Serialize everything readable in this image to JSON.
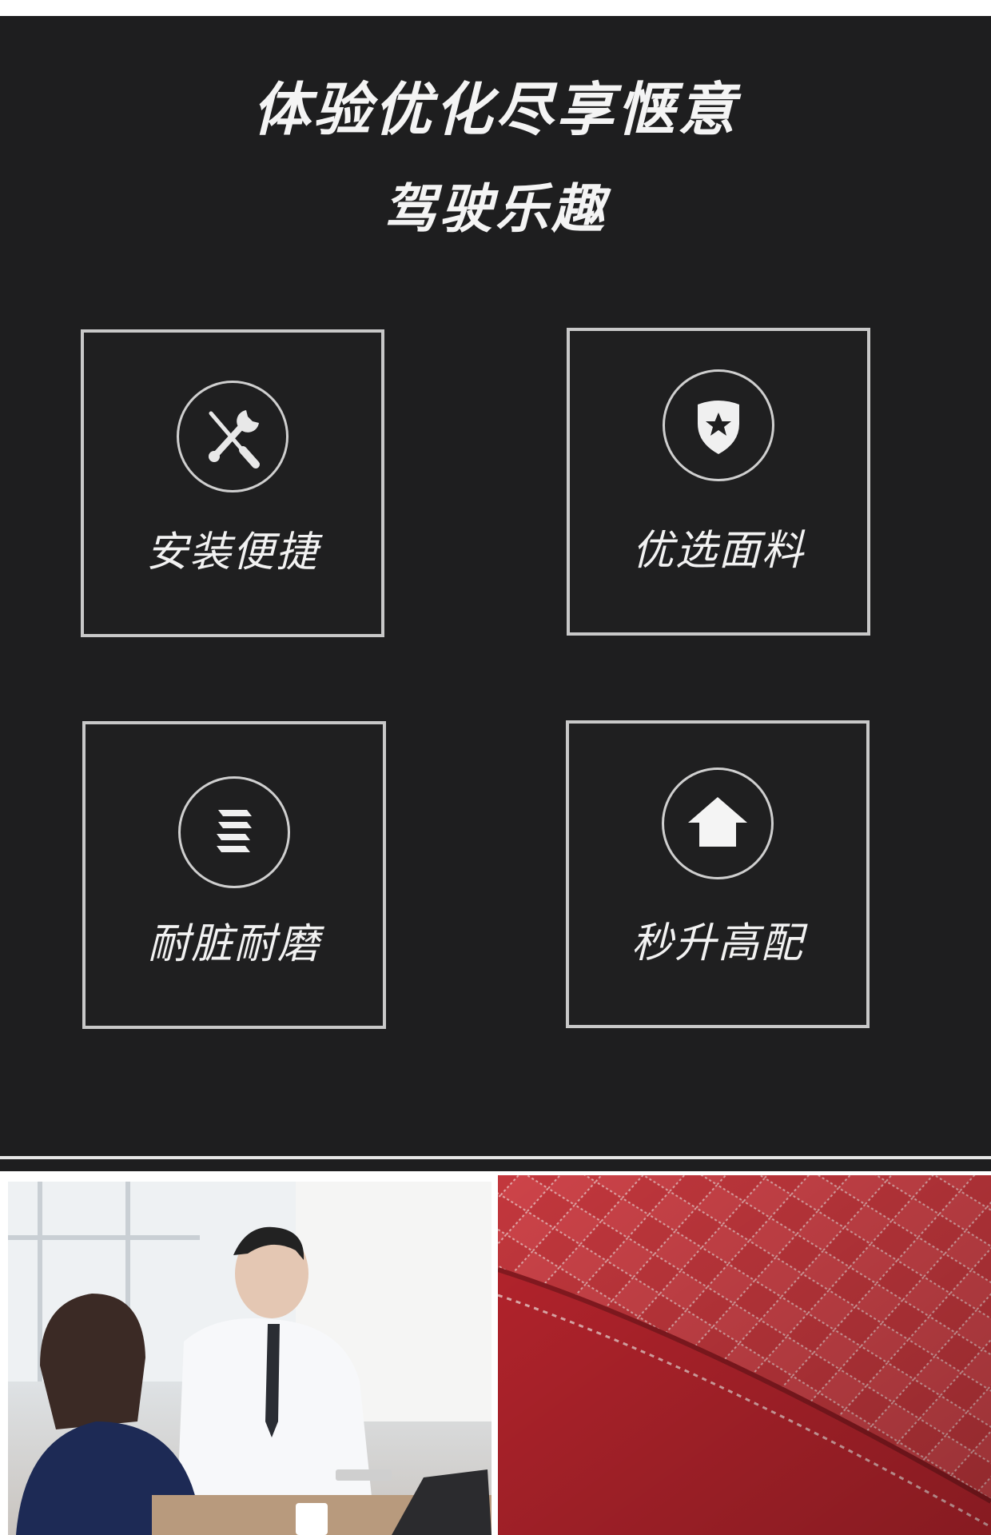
{
  "header": {
    "title_line1": "体验优化尽享惬意",
    "title_line2": "驾驶乐趣"
  },
  "features": [
    {
      "label": "安装便捷",
      "icon": "wrench-screwdriver-icon"
    },
    {
      "label": "优选面料",
      "icon": "shield-star-icon"
    },
    {
      "label": "耐脏耐磨",
      "icon": "layers-icon"
    },
    {
      "label": "秒升高配",
      "icon": "house-up-icon"
    }
  ],
  "colors": {
    "panel_background": "#1e1e1f",
    "card_border": "#c8c8c8",
    "text": "#f4f4f4",
    "leather_red": "#c9323a"
  },
  "photos": {
    "left": "office-meeting-photo",
    "right": "red-quilted-leather-photo"
  }
}
